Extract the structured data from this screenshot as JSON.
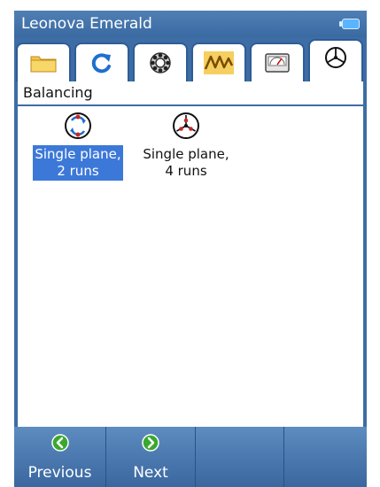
{
  "window": {
    "title": "Leonova Emerald",
    "battery_icon": "battery-icon"
  },
  "tabs": [
    {
      "icon": "folder-icon",
      "active": false
    },
    {
      "icon": "refresh-icon",
      "active": false
    },
    {
      "icon": "bearing-icon",
      "active": false
    },
    {
      "icon": "waveform-icon",
      "active": false
    },
    {
      "icon": "meter-icon",
      "active": false
    },
    {
      "icon": "balancing-icon",
      "active": true
    }
  ],
  "breadcrumb": {
    "text": "Balancing"
  },
  "items": [
    {
      "line1": "Single plane,",
      "line2": "2 runs",
      "icon": "two-run-rotor-icon",
      "selected": true
    },
    {
      "line1": "Single plane,",
      "line2": "4 runs",
      "icon": "four-run-rotor-icon",
      "selected": false
    }
  ],
  "toolbar": {
    "previous_label": "Previous",
    "next_label": "Next"
  },
  "colors": {
    "chrome_blue": "#3e6da5",
    "selection_blue": "#3c78d8",
    "arrow_green": "#3aa830"
  }
}
